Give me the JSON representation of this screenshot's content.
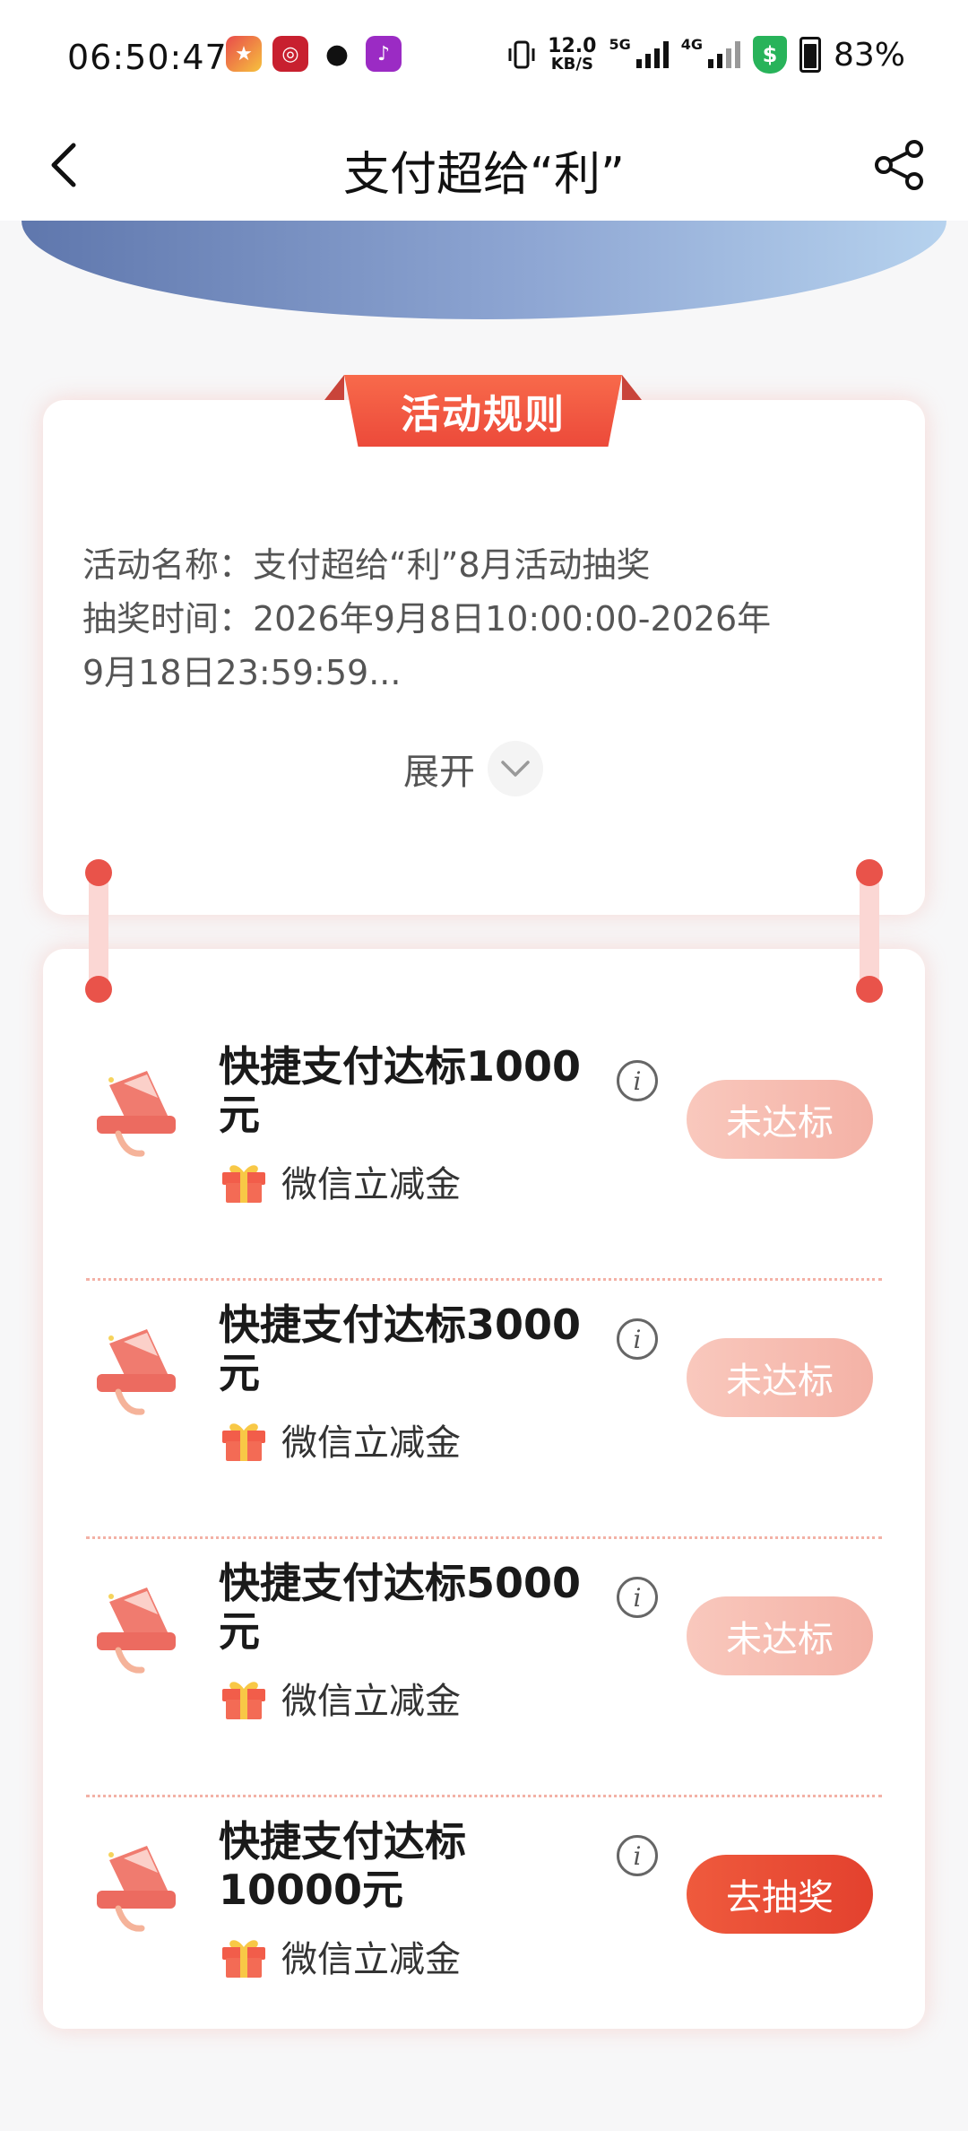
{
  "status_bar": {
    "time": "06:50:47",
    "net_speed_value": "12.0",
    "net_speed_unit": "KB/S",
    "network_1": "5G",
    "network_2": "4G",
    "battery": "83%",
    "app_icons": [
      "mascot-app-icon",
      "bank-app-icon",
      "wechat-icon",
      "notification-app-icon"
    ]
  },
  "nav": {
    "title": "支付超给“利”",
    "back_icon": "chevron-left-icon",
    "share_icon": "share-icon"
  },
  "rules": {
    "tab_label": "活动规则",
    "line1": "活动名称：支付超给“利”8月活动抽奖",
    "line2": "抽奖时间：2026年9月8日10:00:00-2026年",
    "line3": "9月18日23:59:59...",
    "expand_label": "展开"
  },
  "tasks": [
    {
      "title": "快捷支付达标1000元",
      "reward": "微信立减金",
      "button": "未达标",
      "status": "disabled"
    },
    {
      "title": "快捷支付达标3000元",
      "reward": "微信立减金",
      "button": "未达标",
      "status": "disabled"
    },
    {
      "title": "快捷支付达标5000元",
      "reward": "微信立减金",
      "button": "未达标",
      "status": "disabled"
    },
    {
      "title": "快捷支付达标10000元",
      "reward": "微信立减金",
      "button": "去抽奖",
      "status": "active"
    }
  ],
  "colors": {
    "accent": "#e9534a",
    "button_active": "#e3412e",
    "button_disabled": "#f4b2a6",
    "banner": "#8ea6d3"
  }
}
